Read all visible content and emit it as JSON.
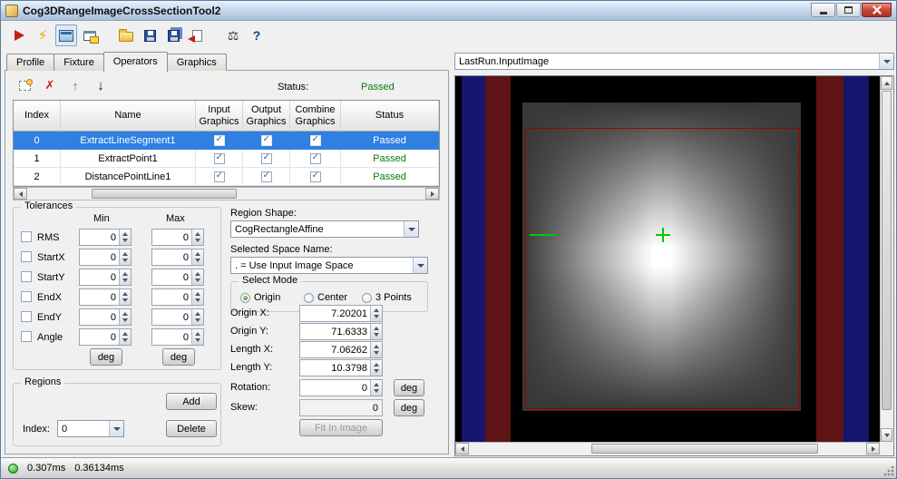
{
  "window": {
    "title": "Cog3DRangeImageCrossSectionTool2"
  },
  "toolbar": {
    "icons": [
      {
        "name": "run-icon"
      },
      {
        "name": "run-continuous-icon",
        "glyph": "⚡"
      },
      {
        "name": "result-display-icon"
      },
      {
        "name": "float-result-icon"
      },
      {
        "name": "open-icon"
      },
      {
        "name": "save-icon"
      },
      {
        "name": "save-all-icon"
      },
      {
        "name": "import-icon"
      },
      {
        "name": "balance-icon",
        "glyph": "⚖"
      },
      {
        "name": "help-icon",
        "glyph": "?"
      }
    ]
  },
  "tabs": {
    "items": [
      {
        "label": "Profile"
      },
      {
        "label": "Fixture"
      },
      {
        "label": "Operators"
      },
      {
        "label": "Graphics"
      }
    ],
    "active": "Operators"
  },
  "operators": {
    "toolbar": {
      "delete_glyph": "✗",
      "up_glyph": "↑",
      "down_glyph": "↓",
      "status_label": "Status:",
      "status_value": "Passed"
    },
    "table": {
      "headers": [
        "Index",
        "Name",
        "Input Graphics",
        "Output Graphics",
        "Combine Graphics",
        "Status"
      ],
      "rows": [
        {
          "index": "0",
          "name": "ExtractLineSegment1",
          "input_graphics": true,
          "output_graphics": true,
          "combine_graphics": true,
          "status": "Passed",
          "selected": true
        },
        {
          "index": "1",
          "name": "ExtractPoint1",
          "input_graphics": true,
          "output_graphics": true,
          "combine_graphics": true,
          "status": "Passed",
          "selected": false
        },
        {
          "index": "2",
          "name": "DistancePointLine1",
          "input_graphics": true,
          "output_graphics": true,
          "combine_graphics": true,
          "status": "Passed",
          "selected": false
        }
      ]
    }
  },
  "tolerances": {
    "title": "Tolerances",
    "min_header": "Min",
    "max_header": "Max",
    "deg_label": "deg",
    "rows": [
      {
        "label": "RMS",
        "min": "0",
        "max": "0",
        "checked": false
      },
      {
        "label": "StartX",
        "min": "0",
        "max": "0",
        "checked": false
      },
      {
        "label": "StartY",
        "min": "0",
        "max": "0",
        "checked": false
      },
      {
        "label": "EndX",
        "min": "0",
        "max": "0",
        "checked": false
      },
      {
        "label": "EndY",
        "min": "0",
        "max": "0",
        "checked": false
      },
      {
        "label": "Angle",
        "min": "0",
        "max": "0",
        "checked": false
      }
    ]
  },
  "region": {
    "shape_label": "Region Shape:",
    "shape_value": "CogRectangleAffine",
    "space_label": "Selected Space Name:",
    "space_value": ". = Use Input Image Space",
    "mode_title": "Select Mode",
    "modes": [
      {
        "label": "Origin",
        "selected": true
      },
      {
        "label": "Center",
        "selected": false
      },
      {
        "label": "3 Points",
        "selected": false
      }
    ],
    "fields": [
      {
        "label": "Origin X:",
        "value": "7.20201"
      },
      {
        "label": "Origin Y:",
        "value": "71.6333"
      },
      {
        "label": "Length X:",
        "value": "7.06262"
      },
      {
        "label": "Length Y:",
        "value": "10.3798"
      },
      {
        "label": "Rotation:",
        "value": "0"
      },
      {
        "label": "Skew:",
        "value": "0"
      }
    ],
    "deg_label": "deg",
    "fit_button_label": "Fit In Image"
  },
  "regions": {
    "title": "Regions",
    "add_label": "Add",
    "delete_label": "Delete",
    "index_label": "Index:",
    "index_value": "0"
  },
  "display": {
    "source": "LastRun.InputImage"
  },
  "status_bar": {
    "time_total": "0.307ms",
    "time_last": "0.36134ms"
  },
  "ui": {
    "check": "✓"
  },
  "image_colors": {
    "background": "#000000",
    "stripe_blue": "#16166e",
    "stripe_red": "#5e1414",
    "region_outline": "#a00000",
    "marker_green": "#00c800"
  }
}
